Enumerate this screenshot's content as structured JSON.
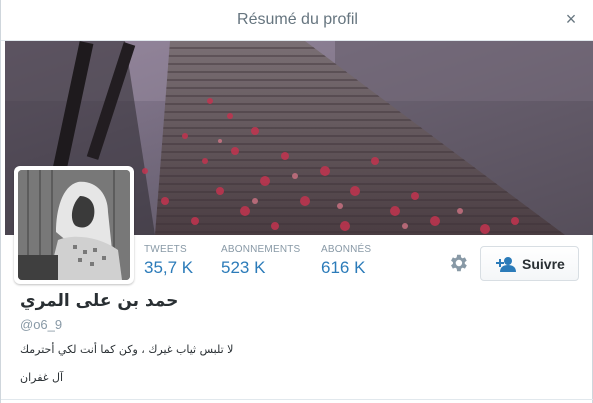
{
  "modal": {
    "title": "Résumé du profil",
    "close_symbol": "×",
    "close_icon": "close-icon"
  },
  "banner": {
    "description_icon": "banner-image"
  },
  "avatar": {
    "icon": "avatar"
  },
  "stats": {
    "tweets": {
      "label": "TWEETS",
      "value": "35,7 K"
    },
    "following": {
      "label": "ABONNEMENTS",
      "value": "523 K"
    },
    "followers": {
      "label": "ABONNÉS",
      "value": "616 K"
    }
  },
  "actions": {
    "settings_icon": "gear-icon",
    "follow_icon": "add-user-icon",
    "follow_label": "Suivre"
  },
  "profile": {
    "name": "حمد بن على المري",
    "handle": "@o6_9",
    "bio": "لا تلبس ثياب غيرك ، وكن كما أنت لكي أحترمك",
    "location": "آل غفران"
  },
  "colors": {
    "accent": "#2b7bb9",
    "muted": "#8899a6",
    "text": "#292f33"
  }
}
